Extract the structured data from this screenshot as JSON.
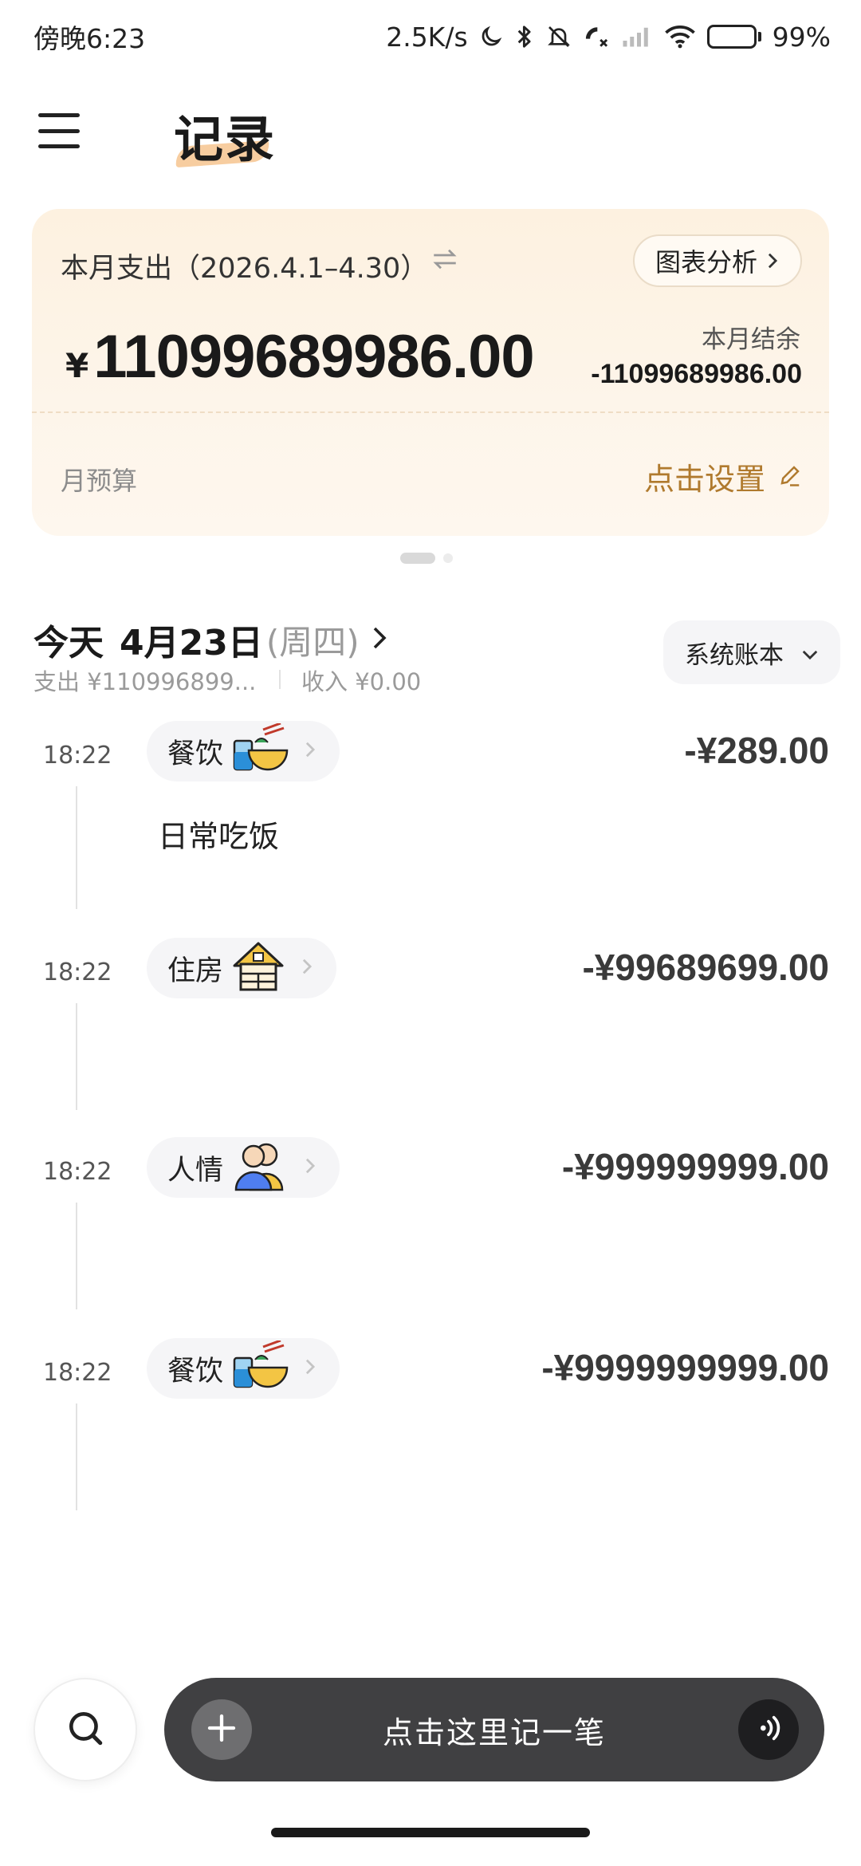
{
  "status_bar": {
    "time": "傍晚6:23",
    "network_speed": "2.5K/s",
    "battery": "99%"
  },
  "header": {
    "title": "记录"
  },
  "summary": {
    "period_label": "本月支出（2026.4.1–4.30）",
    "chart_button": "图表分析",
    "currency": "¥",
    "total_expense": "11099689986.00",
    "balance_label": "本月结余",
    "balance_value": "-11099689986.00",
    "budget_label": "月预算",
    "budget_action": "点击设置",
    "accent_color": "#b07a2e"
  },
  "day": {
    "today": "今天",
    "date": "4月23日",
    "weekday": "(周四)",
    "expense": "支出 ¥110996899...",
    "income": "收入 ¥0.00",
    "account_book": "系统账本"
  },
  "records": [
    {
      "time": "18:22",
      "category": "餐饮",
      "icon": "noodle-bowl-icon",
      "amount": "-¥289.00",
      "note": "日常吃饭"
    },
    {
      "time": "18:22",
      "category": "住房",
      "icon": "house-icon",
      "amount": "-¥99689699.00",
      "note": ""
    },
    {
      "time": "18:22",
      "category": "人情",
      "icon": "people-icon",
      "amount": "-¥999999999.00",
      "note": ""
    },
    {
      "time": "18:22",
      "category": "餐饮",
      "icon": "noodle-bowl-icon",
      "amount": "-¥9999999999.00",
      "note": ""
    }
  ],
  "bottom_bar": {
    "entry_label": "点击这里记一笔"
  }
}
